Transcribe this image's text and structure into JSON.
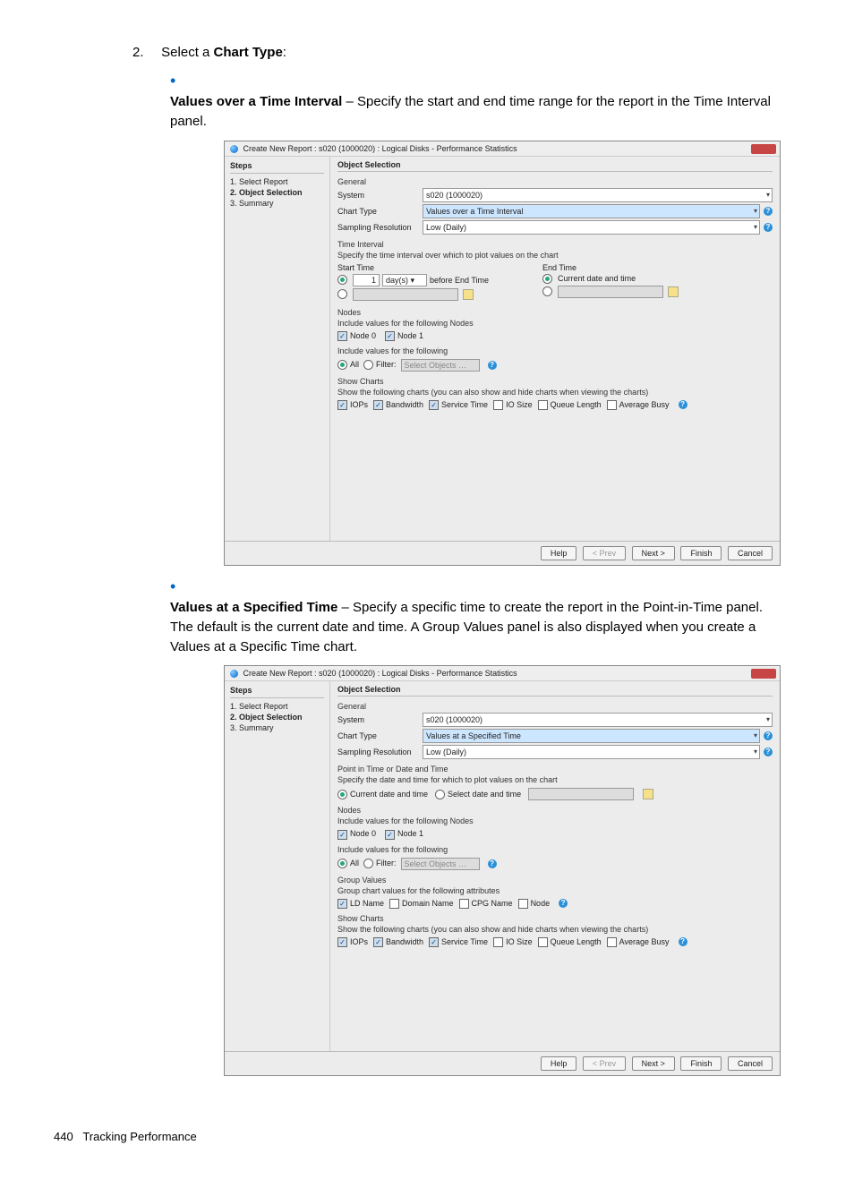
{
  "step": {
    "num": "2.",
    "text_a": "Select a ",
    "text_b": "Chart Type",
    "text_c": ":"
  },
  "bullet1": {
    "title": "Values over a Time Interval",
    "rest": " – Specify the start and end time range for the report in the Time Interval panel."
  },
  "bullet2": {
    "title": "Values at a Specified Time",
    "rest": " – Specify a specific time to create the report in the Point-in-Time panel. The default is the current date and time. A Group Values panel is also displayed when you create a Values at a Specific Time chart."
  },
  "dlg": {
    "title": "Create New Report : s020 (1000020) : Logical Disks - Performance Statistics",
    "stepsHeader": "Steps",
    "steps": [
      "1. Select Report",
      "2. Object Selection",
      "3. Summary"
    ],
    "contentTitle": "Object Selection",
    "general": "General",
    "systemLbl": "System",
    "systemVal": "s020 (1000020)",
    "chartTypeLbl": "Chart Type",
    "samplingLbl": "Sampling Resolution",
    "samplingVal": "Low (Daily)"
  },
  "dlg1": {
    "chartTypeVal": "Values over a Time Interval",
    "ti": {
      "header": "Time Interval",
      "note": "Specify the time interval over which to plot values on the chart",
      "startLbl": "Start Time",
      "endLbl": "End Time",
      "num": "1",
      "unit": "day(s)",
      "before": "before End Time",
      "current": "Current date and time"
    }
  },
  "dlg2": {
    "chartTypeVal": "Values at a Specified Time",
    "pit": {
      "header": "Point in Time or Date and Time",
      "note": "Specify the date and time for which to plot values on the chart",
      "opt1": "Current date and time",
      "opt2": "Select date and time"
    },
    "group": {
      "header": "Group Values",
      "note": "Group chart values for the following attributes",
      "c1": "LD Name",
      "c2": "Domain Name",
      "c3": "CPG Name",
      "c4": "Node"
    }
  },
  "nodes": {
    "header": "Nodes",
    "note": "Include values for the following Nodes",
    "n0": "Node 0",
    "n1": "Node 1"
  },
  "filter": {
    "note": "Include values for the following",
    "all": "All",
    "flt": "Filter:",
    "ph": "Select Objects …"
  },
  "charts": {
    "header": "Show Charts",
    "note": "Show the following charts (you can also show and hide charts when viewing the charts)",
    "c1": "IOPs",
    "c2": "Bandwidth",
    "c3": "Service Time",
    "c4": "IO Size",
    "c5": "Queue Length",
    "c6": "Average Busy"
  },
  "buttons": {
    "help": "Help",
    "prev": "< Prev",
    "next": "Next >",
    "finish": "Finish",
    "cancel": "Cancel"
  },
  "footer": {
    "page": "440",
    "section": "Tracking Performance"
  }
}
